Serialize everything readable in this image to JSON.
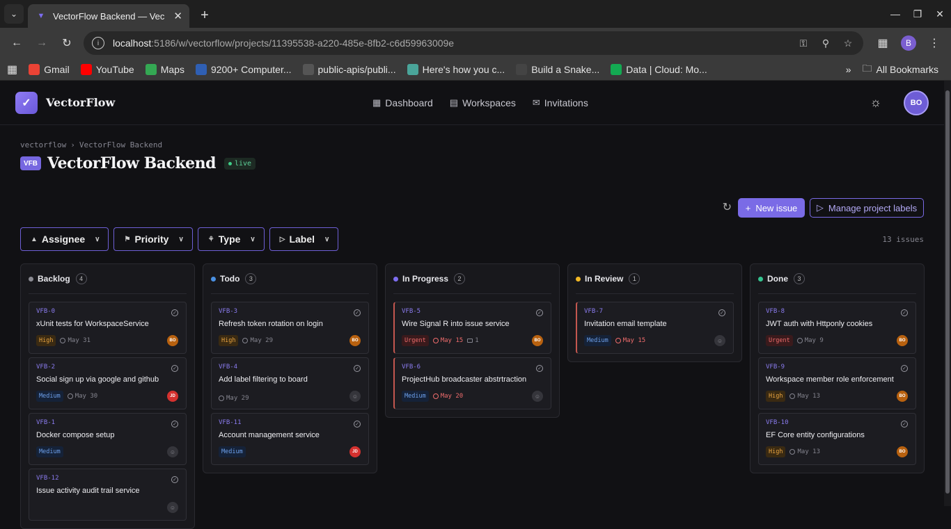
{
  "browser": {
    "tab_title": "VectorFlow Backend — Vec",
    "url_host": "localhost",
    "url_rest": ":5186/w/vectorflow/projects/11395538-a220-485e-8fb2-c6d59963009e",
    "profile_initial": "B",
    "bookmarks": [
      {
        "label": "Gmail",
        "icon": "gmail-icon",
        "color": "#ea4335"
      },
      {
        "label": "YouTube",
        "icon": "youtube-icon",
        "color": "#ff0000"
      },
      {
        "label": "Maps",
        "icon": "maps-icon",
        "color": "#34a853"
      },
      {
        "label": "9200+ Computer...",
        "icon": "site-icon",
        "color": "#2f5fb3"
      },
      {
        "label": "public-apis/publi...",
        "icon": "github-icon",
        "color": "#555555"
      },
      {
        "label": "Here's how you c...",
        "icon": "site-icon",
        "color": "#4aa59a"
      },
      {
        "label": "Build a Snake...",
        "icon": "site-icon",
        "color": "#444444"
      },
      {
        "label": "Data | Cloud: Mo...",
        "icon": "mongodb-icon",
        "color": "#13aa52"
      }
    ],
    "all_bookmarks": "All Bookmarks"
  },
  "app": {
    "brand": "VectorFlow",
    "nav": [
      {
        "label": "Dashboard",
        "icon": "grid-icon"
      },
      {
        "label": "Workspaces",
        "icon": "briefcase-icon"
      },
      {
        "label": "Invitations",
        "icon": "mail-icon"
      }
    ],
    "user_initials": "BO"
  },
  "project": {
    "breadcrumb_root": "vectorflow",
    "breadcrumb_current": "VectorFlow Backend",
    "badge": "VFB",
    "title": "VectorFlow Backend",
    "status": "live",
    "new_issue": "New issue",
    "manage_labels": "Manage project labels",
    "issue_count": "13 issues"
  },
  "filters": [
    "Assignee",
    "Priority",
    "Type",
    "Label"
  ],
  "columns": [
    {
      "name": "Backlog",
      "count": "4",
      "color": "#8a8a92",
      "cards": [
        {
          "id": "VFB-0",
          "title": "xUnit tests for WorkspaceService",
          "priority": "High",
          "due": "May 31",
          "assignee": "BO"
        },
        {
          "id": "VFB-2",
          "title": "Social sign up via google and github",
          "priority": "Medium",
          "due": "May 30",
          "assignee": "JD"
        },
        {
          "id": "VFB-1",
          "title": "Docker compose setup",
          "priority": "Medium",
          "due": "",
          "assignee": ""
        },
        {
          "id": "VFB-12",
          "title": "Issue activity audit trail service",
          "priority": "",
          "due": "",
          "assignee": ""
        }
      ]
    },
    {
      "name": "Todo",
      "count": "3",
      "color": "#4a90e2",
      "cards": [
        {
          "id": "VFB-3",
          "title": "Refresh token rotation on login",
          "priority": "High",
          "due": "May 29",
          "assignee": "BO"
        },
        {
          "id": "VFB-4",
          "title": "Add label filtering to board",
          "priority": "",
          "due": "May 29",
          "assignee": ""
        },
        {
          "id": "VFB-11",
          "title": "Account management service",
          "priority": "Medium",
          "due": "",
          "assignee": "JD"
        }
      ]
    },
    {
      "name": "In Progress",
      "count": "2",
      "color": "#7d6df0",
      "cards": [
        {
          "id": "VFB-5",
          "title": "Wire Signal R into issue service",
          "priority": "Urgent",
          "due": "May 15",
          "overdue": true,
          "comments": "1",
          "assignee": "BO"
        },
        {
          "id": "VFB-6",
          "title": "ProjectHub broadcaster abstrtraction",
          "priority": "Medium",
          "due": "May 20",
          "overdue": true,
          "assignee": ""
        }
      ]
    },
    {
      "name": "In Review",
      "count": "1",
      "color": "#f2b825",
      "cards": [
        {
          "id": "VFB-7",
          "title": "Invitation email template",
          "priority": "Medium",
          "due": "May 15",
          "overdue": true,
          "assignee": ""
        }
      ]
    },
    {
      "name": "Done",
      "count": "3",
      "color": "#34c38f",
      "cards": [
        {
          "id": "VFB-8",
          "title": "JWT auth with Httponly cookies",
          "priority": "Urgent",
          "due": "May 9",
          "assignee": "BO"
        },
        {
          "id": "VFB-9",
          "title": "Workspace member role enforcement",
          "priority": "High",
          "due": "May 13",
          "assignee": "BO"
        },
        {
          "id": "VFB-10",
          "title": "EF Core entity configurations",
          "priority": "High",
          "due": "May 13",
          "assignee": "BO"
        }
      ]
    }
  ]
}
